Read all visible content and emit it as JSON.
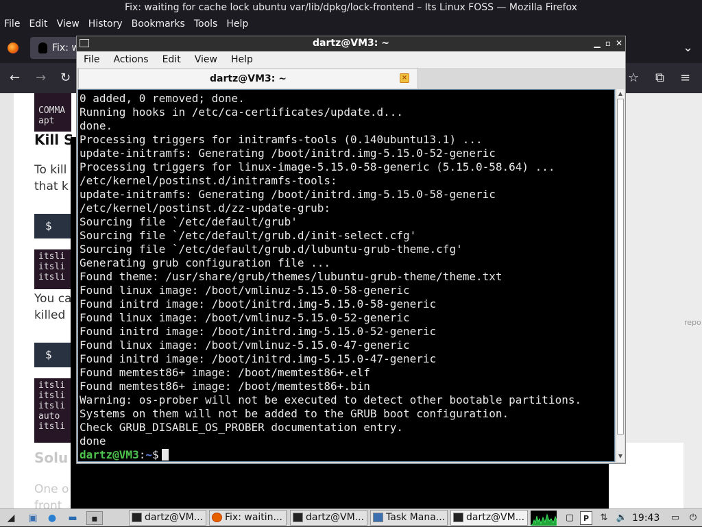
{
  "firefox": {
    "window_title": "Fix: waiting for cache lock ubuntu var/lib/dpkg/lock-frontend – Its Linux FOSS — Mozilla Firefox",
    "menu": [
      "File",
      "Edit",
      "View",
      "History",
      "Bookmarks",
      "Tools",
      "Help"
    ],
    "tab_label": "Fix: w",
    "page": {
      "top_code": [
        "COMMA",
        "apt"
      ],
      "heading_1": "Kill S",
      "para_1": [
        "To kill",
        "that k"
      ],
      "cmd_1": "$ su",
      "code_2": [
        "itsli",
        "itsli",
        "itsli"
      ],
      "para_2": [
        "You ca",
        "killed"
      ],
      "cmd_2": "$ ps",
      "code_3": [
        "itsli",
        "itsli",
        "itsli",
        "auto",
        "itsli"
      ],
      "heading_2": "Solu",
      "para_3": [
        "One o",
        "front"
      ],
      "side_text": "repo"
    }
  },
  "terminal": {
    "window_title": "dartz@VM3: ~",
    "menu": [
      "File",
      "Actions",
      "Edit",
      "View",
      "Help"
    ],
    "tab_label": "dartz@VM3: ~",
    "output": [
      "0 added, 0 removed; done.",
      "Running hooks in /etc/ca-certificates/update.d...",
      "done.",
      "Processing triggers for initramfs-tools (0.140ubuntu13.1) ...",
      "update-initramfs: Generating /boot/initrd.img-5.15.0-52-generic",
      "Processing triggers for linux-image-5.15.0-58-generic (5.15.0-58.64) ...",
      "/etc/kernel/postinst.d/initramfs-tools:",
      "update-initramfs: Generating /boot/initrd.img-5.15.0-58-generic",
      "/etc/kernel/postinst.d/zz-update-grub:",
      "Sourcing file `/etc/default/grub'",
      "Sourcing file `/etc/default/grub.d/init-select.cfg'",
      "Sourcing file `/etc/default/grub.d/lubuntu-grub-theme.cfg'",
      "Generating grub configuration file ...",
      "Found theme: /usr/share/grub/themes/lubuntu-grub-theme/theme.txt",
      "Found linux image: /boot/vmlinuz-5.15.0-58-generic",
      "Found initrd image: /boot/initrd.img-5.15.0-58-generic",
      "Found linux image: /boot/vmlinuz-5.15.0-52-generic",
      "Found initrd image: /boot/initrd.img-5.15.0-52-generic",
      "Found linux image: /boot/vmlinuz-5.15.0-47-generic",
      "Found initrd image: /boot/initrd.img-5.15.0-47-generic",
      "Found memtest86+ image: /boot/memtest86+.elf",
      "Found memtest86+ image: /boot/memtest86+.bin",
      "Warning: os-prober will not be executed to detect other bootable partitions.",
      "Systems on them will not be added to the GRUB boot configuration.",
      "Check GRUB_DISABLE_OS_PROBER documentation entry.",
      "done"
    ],
    "prompt_user": "dartz@VM3",
    "prompt_sep": ":",
    "prompt_path": "~",
    "prompt_symbol": "$"
  },
  "taskbar": {
    "tasks": [
      "dartz@VM...",
      "Fix: waitin...",
      "dartz@VM...",
      "Task Mana...",
      "dartz@VM..."
    ],
    "clock": "19:43"
  },
  "colors": {
    "prompt_user": "#4ec24e",
    "prompt_path": "#5a7fe0",
    "terminal_bg": "#000000",
    "firefox_chrome": "#1c1b22"
  }
}
